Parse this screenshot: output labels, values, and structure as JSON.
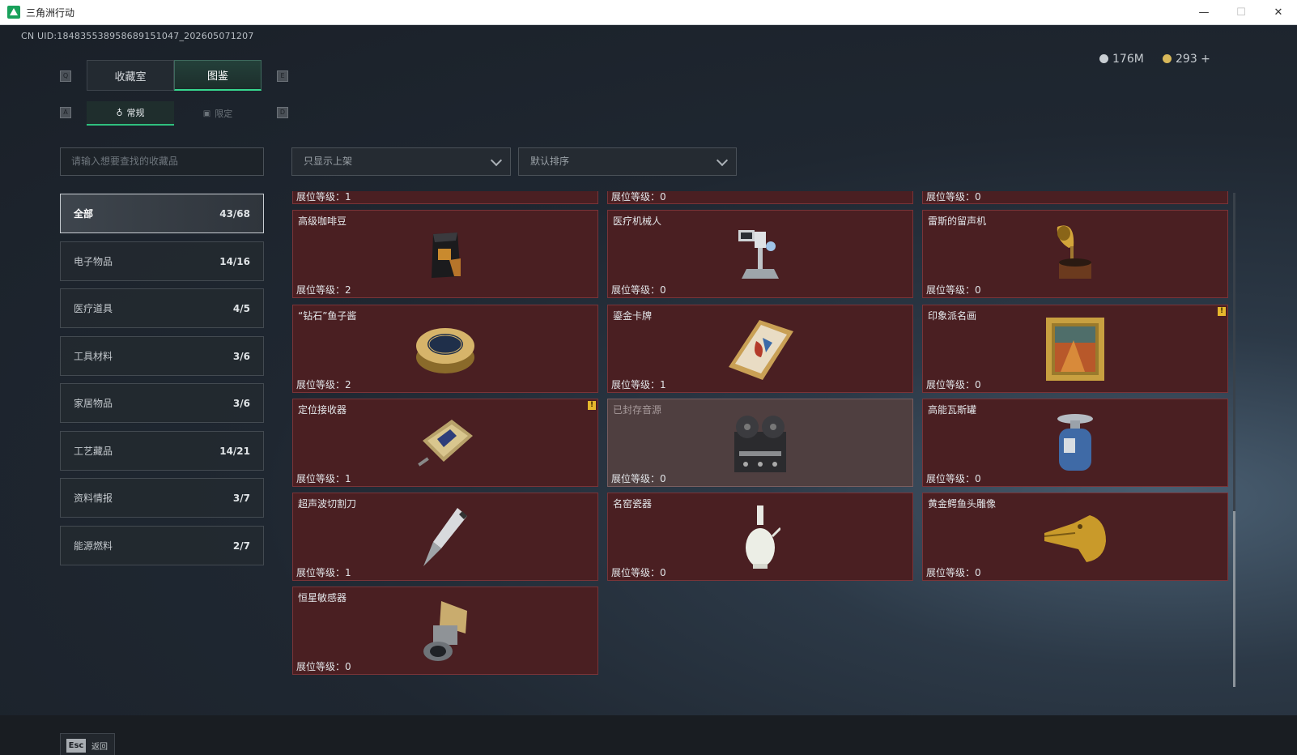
{
  "window": {
    "title": "三角洲行动"
  },
  "header": {
    "uid": "CN UID:18483553895868915104​7_202605071207",
    "currency": [
      {
        "value": "176M",
        "color": "#c9ced3"
      },
      {
        "value": "293 +",
        "color": "#d8b85a"
      }
    ]
  },
  "keys": {
    "q": "Q",
    "e": "E",
    "a": "A",
    "d": "D"
  },
  "tabs": [
    {
      "label": "收藏室"
    },
    {
      "label": "图鉴"
    }
  ],
  "subtabs": [
    {
      "label": "常规"
    },
    {
      "label": "限定"
    }
  ],
  "search": {
    "placeholder": "请输入想要查找的收藏品"
  },
  "filters": {
    "shelf": "只显示上架",
    "sort": "默认排序"
  },
  "categories": [
    {
      "label": "全部",
      "count": "43/68"
    },
    {
      "label": "电子物品",
      "count": "14/16"
    },
    {
      "label": "医疗道具",
      "count": "4/5"
    },
    {
      "label": "工具材料",
      "count": "3/6"
    },
    {
      "label": "家居物品",
      "count": "3/6"
    },
    {
      "label": "工艺藏品",
      "count": "14/21"
    },
    {
      "label": "资料情报",
      "count": "3/7"
    },
    {
      "label": "能源燃料",
      "count": "2/7"
    }
  ],
  "level_prefix": "展位等级：",
  "partial_row": [
    {
      "level": "展位等级：1"
    },
    {
      "level": "展位等级：0"
    },
    {
      "level": "展位等级：0"
    }
  ],
  "items": [
    {
      "name": "高级咖啡豆",
      "level": "展位等级：2",
      "icon": "coffee-bag-icon"
    },
    {
      "name": "医疗机械人",
      "level": "展位等级：0",
      "icon": "medical-robot-icon"
    },
    {
      "name": "雷斯的留声机",
      "level": "展位等级：0",
      "icon": "gramophone-icon"
    },
    {
      "name": "“钻石”鱼子酱",
      "level": "展位等级：2",
      "icon": "caviar-tin-icon"
    },
    {
      "name": "鎏金卡牌",
      "level": "展位等级：1",
      "icon": "gilded-card-icon"
    },
    {
      "name": "印象派名画",
      "level": "展位等级：0",
      "icon": "painting-icon",
      "warn": "!"
    },
    {
      "name": "定位接收器",
      "level": "展位等级：1",
      "icon": "receiver-icon",
      "warn": "!"
    },
    {
      "name": "已封存音源",
      "level": "展位等级：0",
      "icon": "tape-recorder-icon"
    },
    {
      "name": "高能瓦斯罐",
      "level": "展位等级：0",
      "icon": "gas-canister-icon"
    },
    {
      "name": "超声波切割刀",
      "level": "展位等级：1",
      "icon": "ultrasonic-cutter-icon"
    },
    {
      "name": "名窑瓷器",
      "level": "展位等级：0",
      "icon": "porcelain-vase-icon"
    },
    {
      "name": "黄金鳄鱼头雕像",
      "level": "展位等级：0",
      "icon": "gold-crocodile-icon"
    },
    {
      "name": "恒星敏感器",
      "level": "展位等级：0",
      "icon": "star-sensor-icon"
    }
  ],
  "footer": {
    "esc_key": "Esc",
    "esc_label": "返回"
  },
  "colors": {
    "card_bg": "#4a1f22",
    "card_border": "#7a3438",
    "accent": "#37d88f",
    "warn": "#e6b82d"
  }
}
